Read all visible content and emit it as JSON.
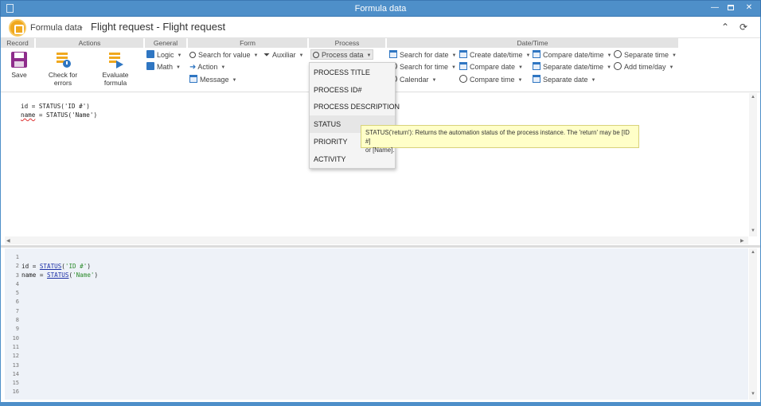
{
  "window": {
    "title": "Formula data"
  },
  "header": {
    "breadcrumb_root": "Formula data",
    "breadcrumb_sep": "›",
    "page_title": "Flight request - Flight request"
  },
  "ribbon": {
    "groups": {
      "record": "Record",
      "actions": "Actions",
      "general": "General",
      "form": "Form",
      "process": "Process",
      "datetime": "Date/Time"
    },
    "save": "Save",
    "check_errors": "Check for errors",
    "evaluate": "Evaluate formula",
    "logic": "Logic",
    "math": "Math",
    "search_value": "Search for value",
    "action": "Action",
    "message": "Message",
    "auxiliar": "Auxiliar",
    "process_data": "Process data",
    "search_date": "Search for date",
    "search_time": "Search for time",
    "calendar": "Calendar",
    "create_datetime": "Create date/time",
    "compare_date": "Compare date",
    "compare_time": "Compare time",
    "compare_datetime": "Compare date/time",
    "separate_datetime": "Separate date/time",
    "separate_date": "Separate date",
    "separate_time": "Separate time",
    "add_timeday": "Add time/day"
  },
  "dropdown": {
    "items": [
      "PROCESS TITLE",
      "PROCESS ID#",
      "PROCESS DESCRIPTION",
      "STATUS",
      "PRIORITY",
      "ACTIVITY"
    ]
  },
  "tooltip": {
    "line1": "STATUS('return'): Returns the automation status of the process instance. The 'return' may be [ID #]",
    "line2": "or [Name]."
  },
  "editor_top": {
    "line1": "id = STATUS('ID #')",
    "line2_var": "name",
    "line2_rest": " = STATUS('Name')"
  },
  "editor_bottom": {
    "line_numbers": [
      "1",
      "2",
      "3",
      "4",
      "5",
      "6",
      "7",
      "8",
      "9",
      "10",
      "11",
      "12",
      "13",
      "14",
      "15",
      "16"
    ],
    "l1_pre": "id = ",
    "l1_fn": "STATUS",
    "l1_open": "(",
    "l1_str": "'ID #'",
    "l1_close": ")",
    "l2_pre": "name = ",
    "l2_fn": "STATUS",
    "l2_open": "(",
    "l2_str": "'Name'",
    "l2_close": ")"
  }
}
